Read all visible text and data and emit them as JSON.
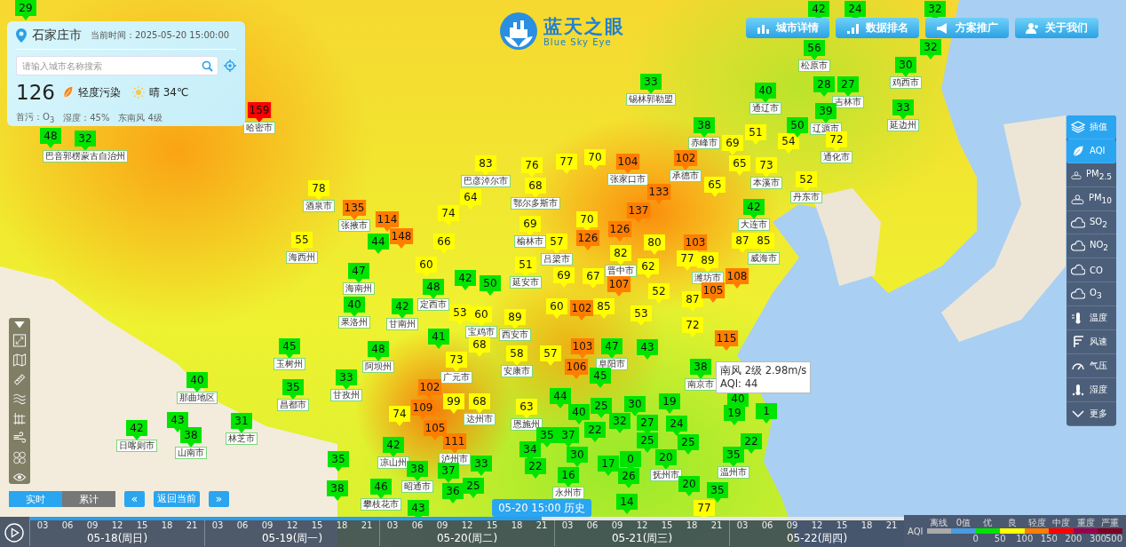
{
  "city_panel": {
    "city": "石家庄市",
    "time_label": "当前时间：",
    "time": "2025-05-20 15:00:00",
    "search": {
      "placeholder": "请输入城市名称搜索"
    },
    "aqi": "126",
    "aqi_level": "轻度污染",
    "weather": "晴 34℃",
    "pollutant": "首污：O$_{3}$",
    "humidity": "湿度：45%",
    "wind": "东南风 4级"
  },
  "logo": {
    "title": "蓝天之眼",
    "subtitle": "Blue Sky Eye"
  },
  "nav_buttons": [
    "城市详情",
    "数据排名",
    "方案推广",
    "关于我们"
  ],
  "layer_menu": [
    {
      "label": "插值",
      "selected": true
    },
    {
      "label": "AQI",
      "selected": true
    },
    {
      "label": "PM$_{2.5}$",
      "selected": false
    },
    {
      "label": "PM$_{10}$",
      "selected": false
    },
    {
      "label": "SO$_{2}$",
      "selected": false
    },
    {
      "label": "NO$_{2}$",
      "selected": false
    },
    {
      "label": "CO",
      "selected": false
    },
    {
      "label": "O$_{3}$",
      "selected": false
    },
    {
      "label": "温度",
      "selected": false
    },
    {
      "label": "风速",
      "selected": false
    },
    {
      "label": "气压",
      "selected": false
    },
    {
      "label": "湿度",
      "selected": false
    },
    {
      "label": "更多",
      "selected": false
    }
  ],
  "mode_tabs": [
    {
      "label": "实时",
      "selected": true
    },
    {
      "label": "累计",
      "selected": false
    }
  ],
  "time_nav": {
    "prev": "«",
    "current": "返回当前",
    "next": "»"
  },
  "markers": [
    {
      "value": "29",
      "color": "#00e400"
    },
    {
      "value": "42",
      "color": "#00e400"
    },
    {
      "value": "24",
      "color": "#00e400"
    },
    {
      "value": "32",
      "color": "#00e400"
    },
    {
      "value": "56",
      "color": "#00e400",
      "city": "松原市"
    },
    {
      "value": "32",
      "color": "#00e400"
    },
    {
      "value": "30",
      "color": "#00e400",
      "city": "鸡西市"
    },
    {
      "value": "33",
      "color": "#00e400",
      "city": "锡林郭勒盟"
    },
    {
      "value": "40",
      "color": "#00e400",
      "city": "通辽市"
    },
    {
      "value": "28",
      "color": "#00e400"
    },
    {
      "value": "27",
      "color": "#00e400",
      "city": "吉林市"
    },
    {
      "value": "159",
      "color": "#ff0000",
      "city": "哈密市"
    },
    {
      "value": "39",
      "color": "#00e400",
      "city": "辽源市"
    },
    {
      "value": "33",
      "color": "#00e400",
      "city": "延边州"
    },
    {
      "value": "48",
      "color": "#00e400"
    },
    {
      "value": "32",
      "color": "#00e400",
      "city": "巴音郭楞蒙古自治州"
    },
    {
      "value": "38",
      "color": "#00e400",
      "city": "赤峰市"
    },
    {
      "value": "51",
      "color": "#ffff00"
    },
    {
      "value": "54",
      "color": "#ffff00"
    },
    {
      "value": "50",
      "color": "#00e400"
    },
    {
      "value": "72",
      "color": "#ffff00",
      "city": "通化市"
    },
    {
      "value": "77",
      "color": "#ffff00"
    },
    {
      "value": "70",
      "color": "#ffff00"
    },
    {
      "value": "104",
      "color": "#ff7e00",
      "city": "张家口市"
    },
    {
      "value": "102",
      "color": "#ff7e00",
      "city": "承德市"
    },
    {
      "value": "69",
      "color": "#ffff00"
    },
    {
      "value": "83",
      "color": "#ffff00",
      "city": "巴彦淖尔市"
    },
    {
      "value": "76",
      "color": "#ffff00"
    },
    {
      "value": "65",
      "color": "#ffff00"
    },
    {
      "value": "73",
      "color": "#ffff00",
      "city": "本溪市"
    },
    {
      "value": "52",
      "color": "#ffff00",
      "city": "丹东市"
    },
    {
      "value": "78",
      "color": "#ffff00",
      "city": "酒泉市"
    },
    {
      "value": "64",
      "color": "#ffff00"
    },
    {
      "value": "68",
      "color": "#ffff00",
      "city": "鄂尔多斯市"
    },
    {
      "value": "133",
      "color": "#ff7e00"
    },
    {
      "value": "65",
      "color": "#ffff00"
    },
    {
      "value": "135",
      "color": "#ff7e00",
      "city": "张掖市"
    },
    {
      "value": "114",
      "color": "#ff7e00"
    },
    {
      "value": "74",
      "color": "#ffff00"
    },
    {
      "value": "69",
      "color": "#ffff00",
      "city": "榆林市"
    },
    {
      "value": "70",
      "color": "#ffff00"
    },
    {
      "value": "137",
      "color": "#ff7e00"
    },
    {
      "value": "42",
      "color": "#00e400",
      "city": "大连市"
    },
    {
      "value": "55",
      "color": "#ffff00",
      "city": "海西州"
    },
    {
      "value": "44",
      "color": "#00e400"
    },
    {
      "value": "148",
      "color": "#ff7e00"
    },
    {
      "value": "66",
      "color": "#ffff00"
    },
    {
      "value": "57",
      "color": "#ffff00",
      "city": "吕梁市"
    },
    {
      "value": "126",
      "color": "#ff7e00"
    },
    {
      "value": "126",
      "color": "#ff7e00"
    },
    {
      "value": "80",
      "color": "#ffff00"
    },
    {
      "value": "103",
      "color": "#ff7e00"
    },
    {
      "value": "87",
      "color": "#ffff00"
    },
    {
      "value": "85",
      "color": "#ffff00",
      "city": "威海市"
    },
    {
      "value": "60",
      "color": "#ffff00"
    },
    {
      "value": "51",
      "color": "#ffff00",
      "city": "延安市"
    },
    {
      "value": "82",
      "color": "#ffff00",
      "city": "晋中市"
    },
    {
      "value": "77",
      "color": "#ffff00"
    },
    {
      "value": "89",
      "color": "#ffff00",
      "city": "潍坊市"
    },
    {
      "value": "47",
      "color": "#00e400",
      "city": "海南州"
    },
    {
      "value": "42",
      "color": "#00e400"
    },
    {
      "value": "50",
      "color": "#00e400"
    },
    {
      "value": "69",
      "color": "#ffff00"
    },
    {
      "value": "67",
      "color": "#ffff00"
    },
    {
      "value": "107",
      "color": "#ff7e00"
    },
    {
      "value": "62",
      "color": "#ffff00"
    },
    {
      "value": "108",
      "color": "#ff7e00"
    },
    {
      "value": "40",
      "color": "#00e400",
      "city": "果洛州"
    },
    {
      "value": "48",
      "color": "#00e400",
      "city": "定西市"
    },
    {
      "value": "52",
      "color": "#ffff00"
    },
    {
      "value": "87",
      "color": "#ffff00"
    },
    {
      "value": "105",
      "color": "#ff7e00"
    },
    {
      "value": "42",
      "color": "#00e400",
      "city": "甘南州"
    },
    {
      "value": "53",
      "color": "#ffff00"
    },
    {
      "value": "60",
      "color": "#ffff00",
      "city": "宝鸡市"
    },
    {
      "value": "89",
      "color": "#ffff00",
      "city": "西安市"
    },
    {
      "value": "60",
      "color": "#ffff00"
    },
    {
      "value": "102",
      "color": "#ff7e00"
    },
    {
      "value": "85",
      "color": "#ffff00"
    },
    {
      "value": "53",
      "color": "#ffff00"
    },
    {
      "value": "72",
      "color": "#ffff00"
    },
    {
      "value": "45",
      "color": "#00e400",
      "city": "玉树州"
    },
    {
      "value": "48",
      "color": "#00e400",
      "city": "阿坝州"
    },
    {
      "value": "41",
      "color": "#00e400"
    },
    {
      "value": "68",
      "color": "#ffff00"
    },
    {
      "value": "103",
      "color": "#ff7e00"
    },
    {
      "value": "47",
      "color": "#00e400",
      "city": "阜阳市"
    },
    {
      "value": "115",
      "color": "#ff7e00"
    },
    {
      "value": "73",
      "color": "#ffff00",
      "city": "广元市"
    },
    {
      "value": "58",
      "color": "#ffff00",
      "city": "安康市"
    },
    {
      "value": "57",
      "color": "#ffff00"
    },
    {
      "value": "106",
      "color": "#ff7e00"
    },
    {
      "value": "43",
      "color": "#00e400"
    },
    {
      "value": "38",
      "color": "#00e400",
      "city": "南京市"
    },
    {
      "value": "40",
      "color": "#00e400",
      "city": "那曲地区"
    },
    {
      "value": "35",
      "color": "#00e400",
      "city": "昌都市"
    },
    {
      "value": "33",
      "color": "#00e400",
      "city": "甘孜州"
    },
    {
      "value": "102",
      "color": "#ff7e00"
    },
    {
      "value": "45",
      "color": "#00e400"
    },
    {
      "value": "109",
      "color": "#ff7e00"
    },
    {
      "value": "99",
      "color": "#ffff00"
    },
    {
      "value": "68",
      "color": "#ffff00",
      "city": "达州市"
    },
    {
      "value": "63",
      "color": "#ffff00",
      "city": "恩施州"
    },
    {
      "value": "44",
      "color": "#00e400"
    },
    {
      "value": "25",
      "color": "#00e400"
    },
    {
      "value": "30",
      "color": "#00e400"
    },
    {
      "value": "19",
      "color": "#00e400"
    },
    {
      "value": "40",
      "color": "#00e400"
    },
    {
      "value": "42",
      "color": "#00e400",
      "city": "日喀则市"
    },
    {
      "value": "43",
      "color": "#00e400"
    },
    {
      "value": "31",
      "color": "#00e400",
      "city": "林芝市"
    },
    {
      "value": "74",
      "color": "#ffff00"
    },
    {
      "value": "105",
      "color": "#ff7e00"
    },
    {
      "value": "40",
      "color": "#00e400"
    },
    {
      "value": "32",
      "color": "#00e400"
    },
    {
      "value": "27",
      "color": "#00e400"
    },
    {
      "value": "24",
      "color": "#00e400"
    },
    {
      "value": "19",
      "color": "#00e400"
    },
    {
      "value": "1",
      "color": "#00e400"
    },
    {
      "value": "38",
      "color": "#00e400",
      "city": "山南市"
    },
    {
      "value": "42",
      "color": "#00e400",
      "city": "凉山州"
    },
    {
      "value": "111",
      "color": "#ff7e00",
      "city": "泸州市"
    },
    {
      "value": "35",
      "color": "#00e400"
    },
    {
      "value": "37",
      "color": "#00e400"
    },
    {
      "value": "22",
      "color": "#00e400"
    },
    {
      "value": "25",
      "color": "#00e400"
    },
    {
      "value": "25",
      "color": "#00e400"
    },
    {
      "value": "22",
      "color": "#00e400"
    },
    {
      "value": "35",
      "color": "#00e400"
    },
    {
      "value": "38",
      "color": "#00e400",
      "city": "昭通市"
    },
    {
      "value": "33",
      "color": "#00e400"
    },
    {
      "value": "34",
      "color": "#00e400"
    },
    {
      "value": "22",
      "color": "#00e400"
    },
    {
      "value": "30",
      "color": "#00e400"
    },
    {
      "value": "17",
      "color": "#00e400"
    },
    {
      "value": "0",
      "color": "#00e400"
    },
    {
      "value": "20",
      "color": "#00e400",
      "city": "抚州市"
    },
    {
      "value": "35",
      "color": "#00e400",
      "city": "温州市"
    },
    {
      "value": "38",
      "color": "#00e400"
    },
    {
      "value": "46",
      "color": "#00e400",
      "city": "攀枝花市"
    },
    {
      "value": "37",
      "color": "#00e400"
    },
    {
      "value": "36",
      "color": "#00e400"
    },
    {
      "value": "25",
      "color": "#00e400"
    },
    {
      "value": "16",
      "color": "#00e400",
      "city": "永州市"
    },
    {
      "value": "26",
      "color": "#00e400"
    },
    {
      "value": "20",
      "color": "#00e400"
    },
    {
      "value": "43",
      "color": "#00e400"
    },
    {
      "value": "14",
      "color": "#00e400"
    },
    {
      "value": "77",
      "color": "#ffff00"
    },
    {
      "value": "35",
      "color": "#00e400"
    }
  ],
  "tooltip": {
    "wind": "南风 2级 2.98m/s",
    "aqi": "AQI: 44"
  },
  "timeline": {
    "current": "05-20 15:00 历史",
    "level": 0.586,
    "days": [
      {
        "label": "05-18(周日)",
        "hours": [
          "03",
          "06",
          "09",
          "12",
          "15",
          "18",
          "21"
        ]
      },
      {
        "label": "05-19(周一)",
        "hours": [
          "03",
          "06",
          "09",
          "12",
          "15",
          "18",
          "21"
        ]
      },
      {
        "label": "05-20(周二)",
        "hours": [
          "03",
          "06",
          "09",
          "12",
          "15",
          "18",
          "21"
        ]
      },
      {
        "label": "05-21(周三)",
        "hours": [
          "03",
          "06",
          "09",
          "12",
          "15",
          "18",
          "21"
        ]
      },
      {
        "label": "05-22(周四)",
        "hours": [
          "03",
          "06",
          "09",
          "12",
          "15",
          "18",
          "21"
        ]
      }
    ]
  },
  "legend": {
    "title": "AQI",
    "bands": [
      {
        "label": "离线",
        "color": "#aaaaaa"
      },
      {
        "label": "0值",
        "color": "#4a9be0"
      },
      {
        "label": "优",
        "color": "#00e400"
      },
      {
        "label": "良",
        "color": "#ffff00"
      },
      {
        "label": "轻度",
        "color": "#ff7e00"
      },
      {
        "label": "中度",
        "color": "#ff0000"
      },
      {
        "label": "重度",
        "color": "#99004c"
      },
      {
        "label": "严重",
        "color": "#7e0023"
      }
    ],
    "ticks": [
      "0",
      "50",
      "100",
      "150",
      "200",
      "300",
      "500"
    ]
  }
}
